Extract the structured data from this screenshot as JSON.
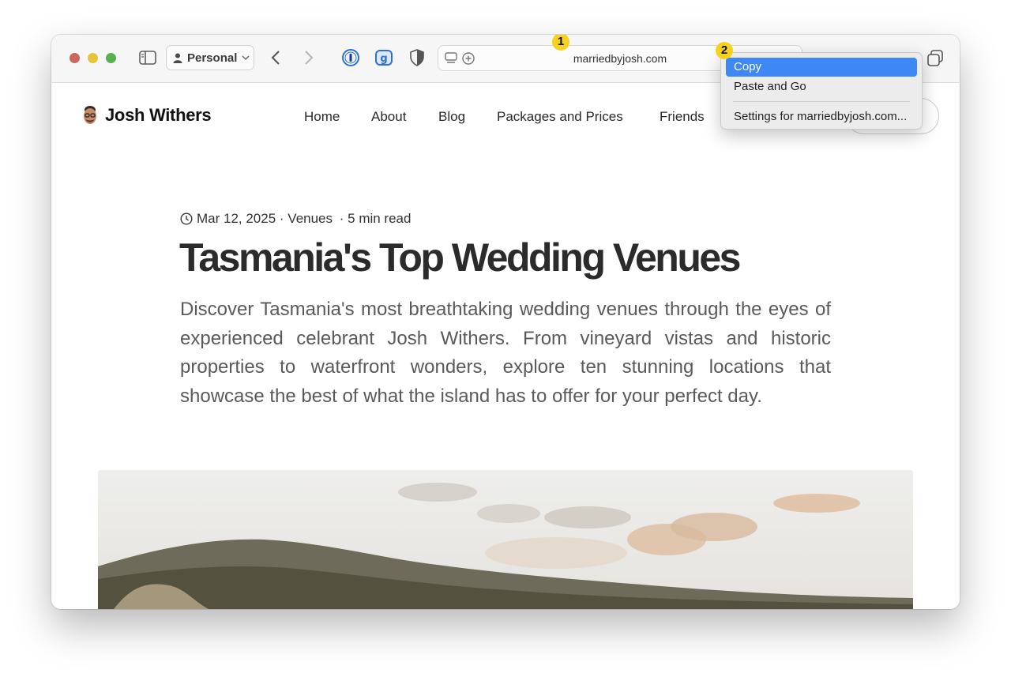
{
  "browser": {
    "profile_label": "Personal",
    "url": "marriedbyjosh.com",
    "badges": [
      "1",
      "2"
    ],
    "context_menu": {
      "items": [
        "Copy",
        "Paste and Go",
        "Settings for marriedbyjosh.com..."
      ],
      "selected": "Copy"
    },
    "icons": [
      "sidebar-icon",
      "person-icon",
      "chevron-down-icon",
      "back-icon",
      "forward-icon",
      "onepassword-icon",
      "extension-icon",
      "shield-icon",
      "tab-overview-icon",
      "add-icon",
      "new-tab-icon"
    ],
    "colors": {
      "highlight": "#3d88f4",
      "badge": "#f6d21f"
    }
  },
  "site": {
    "brand": "Josh Withers",
    "nav": [
      "Home",
      "About",
      "Blog",
      "Packages and Prices",
      "Friends"
    ]
  },
  "article": {
    "date": "Mar 12, 2025",
    "category": "Venues",
    "read_time": "5 min read",
    "separator": " · ",
    "title": "Tasmania's Top Wedding Venues",
    "lead": "Discover Tasmania's most breathtaking wedding venues through the eyes of experienced celebrant Josh Withers. From vineyard vistas and historic properties to waterfront wonders, explore ten stunning locations that showcase the best of what the island has to offer for your perfect day."
  }
}
